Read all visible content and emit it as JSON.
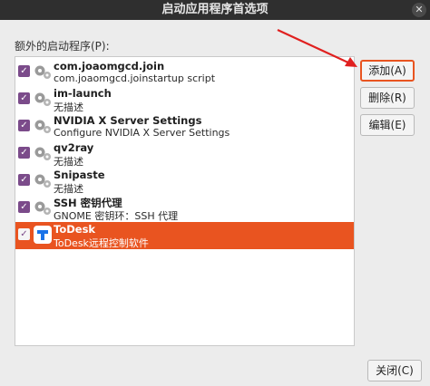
{
  "window": {
    "title": "启动应用程序首选项",
    "close_glyph": "✕"
  },
  "section_label": "额外的启动程序(P):",
  "items": [
    {
      "name": "com.joaomgcd.join",
      "desc": "com.joaomgcd.joinstartup script",
      "checked": true,
      "icon": "gears-icon"
    },
    {
      "name": "im-launch",
      "desc": "无描述",
      "checked": true,
      "icon": "gears-icon"
    },
    {
      "name": "NVIDIA X Server Settings",
      "desc": "Configure NVIDIA X Server Settings",
      "checked": true,
      "icon": "gears-icon"
    },
    {
      "name": "qv2ray",
      "desc": "无描述",
      "checked": true,
      "icon": "gears-icon"
    },
    {
      "name": "Snipaste",
      "desc": "无描述",
      "checked": true,
      "icon": "gears-icon"
    },
    {
      "name": "SSH 密钥代理",
      "desc": "GNOME 密钥环：SSH 代理",
      "checked": true,
      "icon": "gears-icon"
    },
    {
      "name": "ToDesk",
      "desc": "ToDesk远程控制软件",
      "checked": true,
      "icon": "todesk-icon",
      "selected": true
    }
  ],
  "buttons": {
    "add": "添加(A)",
    "remove": "删除(R)",
    "edit": "编辑(E)",
    "close": "关闭(C)"
  },
  "check_glyph": "✓",
  "colors": {
    "accent": "#e95420",
    "checkbox": "#7b4b8a",
    "annotation_arrow": "#e0201f",
    "todesk_blue": "#1a73e8"
  }
}
